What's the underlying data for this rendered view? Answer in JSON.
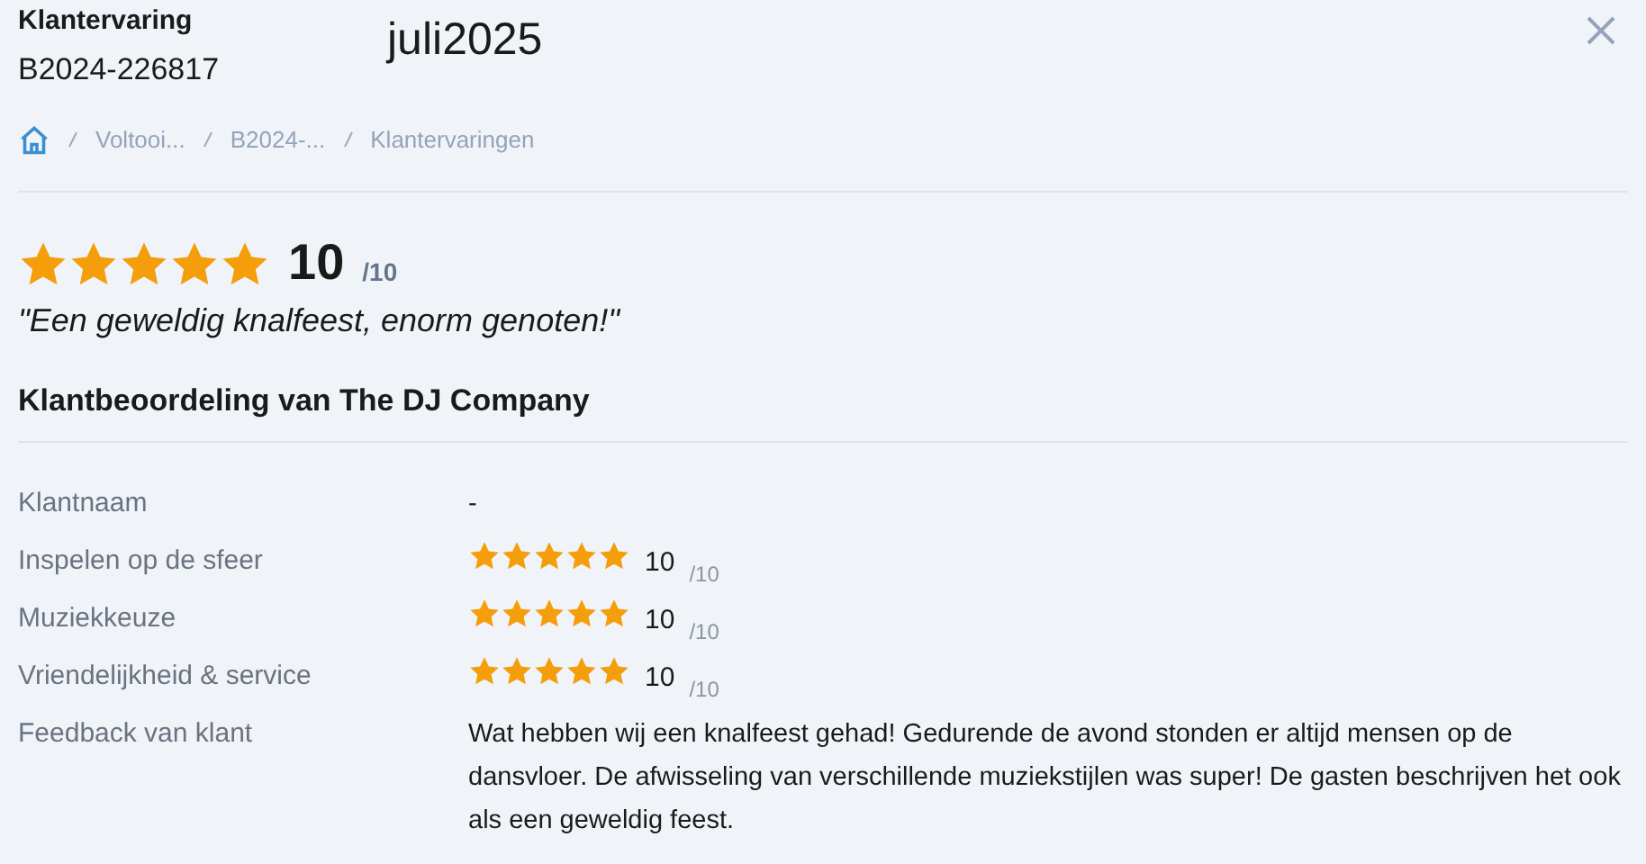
{
  "header": {
    "title": "Klantervaring",
    "code": "B2024-226817",
    "date": "juli2025"
  },
  "breadcrumb": [
    "Voltooi...",
    "B2024-...",
    "Klantervaringen"
  ],
  "overall": {
    "stars": 5,
    "score": "10",
    "max": "/10",
    "quote": "\"Een geweldig knalfeest, enorm genoten!\""
  },
  "section_title": "Klantbeoordeling van The DJ Company",
  "rows": [
    {
      "kind": "text",
      "label": "Klantnaam",
      "value": "-"
    },
    {
      "kind": "rating",
      "label": "Inspelen op de sfeer",
      "stars": 5,
      "score": "10",
      "max": "/10"
    },
    {
      "kind": "rating",
      "label": "Muziekkeuze",
      "stars": 5,
      "score": "10",
      "max": "/10"
    },
    {
      "kind": "rating",
      "label": "Vriendelijkheid & service",
      "stars": 5,
      "score": "10",
      "max": "/10"
    },
    {
      "kind": "text",
      "label": "Feedback van klant",
      "value": "Wat hebben wij een knalfeest gehad! Gedurende de avond stonden er altijd mensen op de dansvloer. De afwisseling van verschillende muziekstijlen was super! De gasten beschrijven het ook als een geweldig feest."
    }
  ]
}
